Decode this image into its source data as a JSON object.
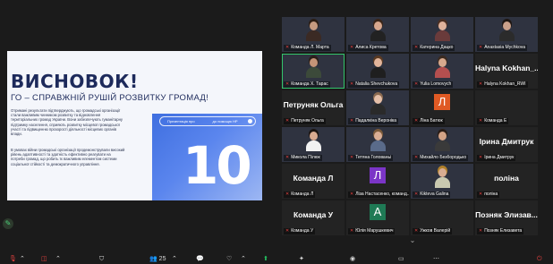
{
  "slide": {
    "title": "ВИСНОВОК!",
    "subtitle": "ГО – СПРАВЖНІЙ РУШІЙ РОЗВИТКУ ГРОМАД!",
    "paragraph1": "Отримані результати підтверджують, що громадські організації стали важливим чинником розвитку та відновлення територіальних громад України. Вони забезпечують гуманітарну підтримку населення, сприяють розвитку місцевої громадської участі та підвищенню прозорості діяльності місцевих органів влади.",
    "paragraph2": "В умовах війни громадські організації продемонстрували високий рівень адаптивності та здатність ефективно реагувати на потреби громад, що робить їх важливим елементом системи соціальної стійкості та демократичного управління.",
    "pill_left": "Презентація про",
    "pill_right": "до помощю НР",
    "big_number": "10"
  },
  "tiles": [
    {
      "name": "Команда Л. Марта",
      "kind": "video",
      "skin": "#c59a80",
      "hair": "#2b1d14",
      "shirt": "#3b2a24"
    },
    {
      "name": "Алиса Кретова",
      "kind": "video",
      "skin": "#d8a88e",
      "hair": "#3a2619",
      "shirt": "#222222"
    },
    {
      "name": "Катерина Дацко",
      "kind": "video",
      "skin": "#e0b39c",
      "hair": "#4b2f22",
      "shirt": "#6a3b3b"
    },
    {
      "name": "Anastasia Mychkova",
      "kind": "video",
      "skin": "#caa08a",
      "hair": "#1e1612",
      "shirt": "#2b2b2b"
    },
    {
      "name": "Команда Х. Тарас",
      "kind": "video",
      "skin": "#c49478",
      "hair": "#2a1f18",
      "shirt": "#3c4a3a",
      "active": true
    },
    {
      "name": "Natalia Shevchukova",
      "kind": "video",
      "skin": "#e2b59b",
      "hair": "#5a3a22",
      "shirt": "#1f1f1f"
    },
    {
      "name": "Yulia Lomovych",
      "kind": "video",
      "skin": "#d7a98e",
      "hair": "#3a2a20",
      "shirt": "#b44f4f"
    },
    {
      "name": "Halyna Kokhan_RWI",
      "kind": "name",
      "display": "Halyna Kokhan_..."
    },
    {
      "name": "Петруняк Ольга",
      "kind": "name",
      "display": "Петруняк Ольга"
    },
    {
      "name": "Падалкіна Вероніка",
      "kind": "video",
      "skin": "#e5bfa8",
      "hair": "#8a6a50",
      "shirt": "#2a2a2a"
    },
    {
      "name": "Ліна Батюк",
      "kind": "avatar",
      "letter": "Л",
      "color": "#e05a24"
    },
    {
      "name": "Команда Е",
      "kind": "dark"
    },
    {
      "name": "Микола Пілюк",
      "kind": "video",
      "skin": "#d9ab90",
      "hair": "#1b1410",
      "shirt": "#f2f2f2"
    },
    {
      "name": "Тетяна Голованьі",
      "kind": "video",
      "skin": "#d9ae95",
      "hair": "#7a5a3a",
      "shirt": "#5a6b8a"
    },
    {
      "name": "Михайло Безбородько",
      "kind": "video",
      "skin": "#d3a386",
      "hair": "#2a1d16",
      "shirt": "#3a3a3a"
    },
    {
      "name": "Ірина Дмитрук",
      "kind": "name",
      "display": "Ірина Дмитрук"
    },
    {
      "name": "Команда Л",
      "kind": "name",
      "display": "Команда Л"
    },
    {
      "name": "Ліза Настасенко, команд...",
      "kind": "avatar",
      "letter": "Л",
      "color": "#7b35c7"
    },
    {
      "name": "Kikteva Galina",
      "kind": "video",
      "skin": "#d8ad92",
      "hair": "#b0802a",
      "shirt": "#c9c9b0"
    },
    {
      "name": "поліна",
      "kind": "name",
      "display": "поліна"
    },
    {
      "name": "Команда У",
      "kind": "name",
      "display": "Команда У"
    },
    {
      "name": "Юлія Марушкевич",
      "kind": "avatar",
      "letter": "А",
      "color": "#1f7a55"
    },
    {
      "name": "Ужков Валерій",
      "kind": "dark"
    },
    {
      "name": "Позняк Елизавета",
      "kind": "name",
      "display": "Позняк Элизав..."
    }
  ],
  "toolbar": {
    "participants_count": "25"
  }
}
